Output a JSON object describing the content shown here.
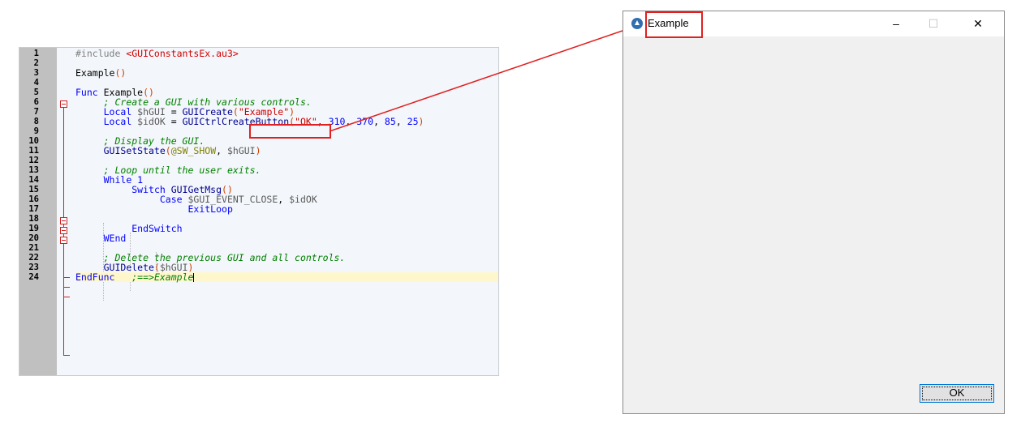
{
  "editor": {
    "lines": [
      {
        "n": "1",
        "parts": [
          [
            "pp",
            "#include "
          ],
          [
            "inc",
            "<GUIConstantsEx.au3>"
          ]
        ]
      },
      {
        "n": "2",
        "parts": []
      },
      {
        "n": "3",
        "parts": [
          [
            "txt",
            "Example"
          ],
          [
            "par",
            "()"
          ]
        ]
      },
      {
        "n": "4",
        "parts": []
      },
      {
        "n": "5",
        "parts": [
          [
            "kw",
            "Func "
          ],
          [
            "txt",
            "Example"
          ],
          [
            "par",
            "()"
          ]
        ]
      },
      {
        "n": "6",
        "parts": [
          [
            "txt",
            "     "
          ],
          [
            "cm",
            "; Create a GUI with various controls."
          ]
        ]
      },
      {
        "n": "7",
        "parts": [
          [
            "txt",
            "     "
          ],
          [
            "kw",
            "Local "
          ],
          [
            "var",
            "$hGUI"
          ],
          [
            "txt",
            " = "
          ],
          [
            "fn",
            "GUICreate"
          ],
          [
            "par",
            "("
          ],
          [
            "str",
            "\"Example\""
          ],
          [
            "par",
            ")"
          ]
        ]
      },
      {
        "n": "8",
        "parts": [
          [
            "txt",
            "     "
          ],
          [
            "kw",
            "Local "
          ],
          [
            "var",
            "$idOK"
          ],
          [
            "txt",
            " = "
          ],
          [
            "fn",
            "GUICtrlCreateButton"
          ],
          [
            "par",
            "("
          ],
          [
            "str",
            "\"OK\""
          ],
          [
            "txt",
            ", "
          ],
          [
            "num",
            "310"
          ],
          [
            "txt",
            ", "
          ],
          [
            "num",
            "370"
          ],
          [
            "txt",
            ", "
          ],
          [
            "num",
            "85"
          ],
          [
            "txt",
            ", "
          ],
          [
            "num",
            "25"
          ],
          [
            "par",
            ")"
          ]
        ]
      },
      {
        "n": "9",
        "parts": []
      },
      {
        "n": "10",
        "parts": [
          [
            "txt",
            "     "
          ],
          [
            "cm",
            "; Display the GUI."
          ]
        ]
      },
      {
        "n": "11",
        "parts": [
          [
            "txt",
            "     "
          ],
          [
            "fn",
            "GUISetState"
          ],
          [
            "par",
            "("
          ],
          [
            "mac",
            "@SW_SHOW"
          ],
          [
            "txt",
            ", "
          ],
          [
            "var",
            "$hGUI"
          ],
          [
            "par",
            ")"
          ]
        ]
      },
      {
        "n": "12",
        "parts": []
      },
      {
        "n": "13",
        "parts": [
          [
            "txt",
            "     "
          ],
          [
            "cm",
            "; Loop until the user exits."
          ]
        ]
      },
      {
        "n": "14",
        "parts": [
          [
            "txt",
            "     "
          ],
          [
            "kw",
            "While "
          ],
          [
            "num",
            "1"
          ]
        ]
      },
      {
        "n": "15",
        "parts": [
          [
            "txt",
            "          "
          ],
          [
            "kw",
            "Switch "
          ],
          [
            "fn",
            "GUIGetMsg"
          ],
          [
            "par",
            "()"
          ]
        ]
      },
      {
        "n": "16",
        "parts": [
          [
            "txt",
            "               "
          ],
          [
            "kw",
            "Case "
          ],
          [
            "var",
            "$GUI_EVENT_CLOSE"
          ],
          [
            "txt",
            ", "
          ],
          [
            "var",
            "$idOK"
          ]
        ]
      },
      {
        "n": "17",
        "parts": [
          [
            "txt",
            "                    "
          ],
          [
            "kw",
            "ExitLoop"
          ]
        ]
      },
      {
        "n": "18",
        "parts": []
      },
      {
        "n": "19",
        "parts": [
          [
            "txt",
            "          "
          ],
          [
            "kw",
            "EndSwitch"
          ]
        ]
      },
      {
        "n": "20",
        "parts": [
          [
            "txt",
            "     "
          ],
          [
            "kw",
            "WEnd"
          ]
        ]
      },
      {
        "n": "21",
        "parts": []
      },
      {
        "n": "22",
        "parts": [
          [
            "txt",
            "     "
          ],
          [
            "cm",
            "; Delete the previous GUI and all controls."
          ]
        ]
      },
      {
        "n": "23",
        "parts": [
          [
            "txt",
            "     "
          ],
          [
            "fn",
            "GUIDelete"
          ],
          [
            "par",
            "("
          ],
          [
            "var",
            "$hGUI"
          ],
          [
            "par",
            ")"
          ]
        ]
      },
      {
        "n": "24",
        "parts": [
          [
            "kw",
            "EndFunc"
          ],
          [
            "txt",
            "   "
          ],
          [
            "cm",
            ";==>Example"
          ]
        ]
      }
    ]
  },
  "window": {
    "title": "Example",
    "icon": "autoit-icon",
    "minimize_glyph": "–",
    "maximize_glyph": "☐",
    "close_glyph": "✕",
    "ok_label": "OK"
  },
  "annotation": {
    "color": "#e02020"
  }
}
